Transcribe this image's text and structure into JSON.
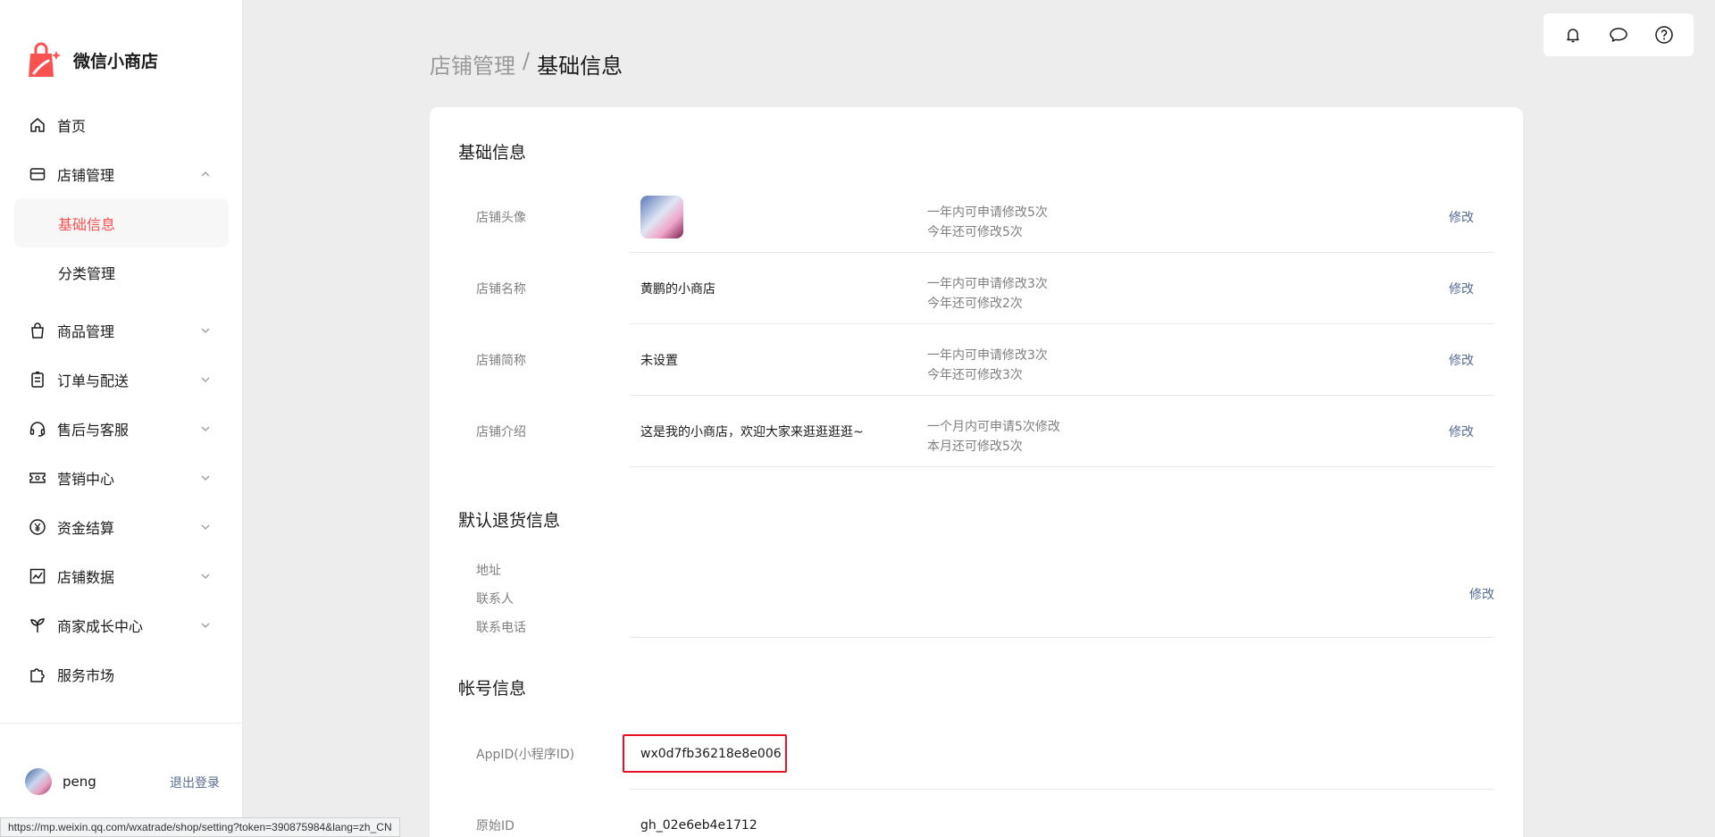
{
  "app": {
    "name": "微信小商店"
  },
  "sidebar": {
    "items": [
      {
        "label": "首页",
        "icon": "home-icon"
      },
      {
        "label": "店铺管理",
        "icon": "store-icon",
        "expanded": true,
        "children": [
          {
            "label": "基础信息",
            "active": true
          },
          {
            "label": "分类管理"
          }
        ]
      },
      {
        "label": "商品管理",
        "icon": "bag-icon"
      },
      {
        "label": "订单与配送",
        "icon": "clipboard-icon"
      },
      {
        "label": "售后与客服",
        "icon": "headset-icon"
      },
      {
        "label": "营销中心",
        "icon": "ticket-icon"
      },
      {
        "label": "资金结算",
        "icon": "yen-icon"
      },
      {
        "label": "店铺数据",
        "icon": "chart-icon"
      },
      {
        "label": "商家成长中心",
        "icon": "sprout-icon"
      },
      {
        "label": "服务市场",
        "icon": "puzzle-icon"
      }
    ],
    "user": {
      "name": "peng",
      "logout": "退出登录"
    }
  },
  "topbar": {
    "icons": [
      "bell-icon",
      "chat-icon",
      "help-icon"
    ]
  },
  "breadcrumb": {
    "parent": "店铺管理",
    "separator": "/",
    "current": "基础信息"
  },
  "basic": {
    "title": "基础信息",
    "rows": [
      {
        "label": "店铺头像",
        "value": "",
        "limit1": "一年内可申请修改5次",
        "limit2": "今年还可修改5次",
        "edit": "修改"
      },
      {
        "label": "店铺名称",
        "value": "黄鹏的小商店",
        "limit1": "一年内可申请修改3次",
        "limit2": "今年还可修改2次",
        "edit": "修改"
      },
      {
        "label": "店铺简称",
        "value": "未设置",
        "limit1": "一年内可申请修改3次",
        "limit2": "今年还可修改3次",
        "edit": "修改"
      },
      {
        "label": "店铺介绍",
        "value": "这是我的小商店，欢迎大家来逛逛逛逛~",
        "limit1": "一个月内可申请5次修改",
        "limit2": "本月还可修改5次",
        "edit": "修改"
      }
    ]
  },
  "returns": {
    "title": "默认退货信息",
    "labels": [
      "地址",
      "联系人",
      "联系电话"
    ],
    "edit": "修改"
  },
  "account": {
    "title": "帐号信息",
    "appid_label": "AppID(小程序ID)",
    "appid": "wx0d7fb36218e8e006",
    "origin_label": "原始ID",
    "origin": "gh_02e6eb4e1712"
  },
  "status_url": "https://mp.weixin.qq.com/wxatrade/shop/setting?token=390875984&lang=zh_CN",
  "colors": {
    "accent": "#fa5151",
    "link": "#576b95",
    "highlight_border": "#e81123"
  }
}
